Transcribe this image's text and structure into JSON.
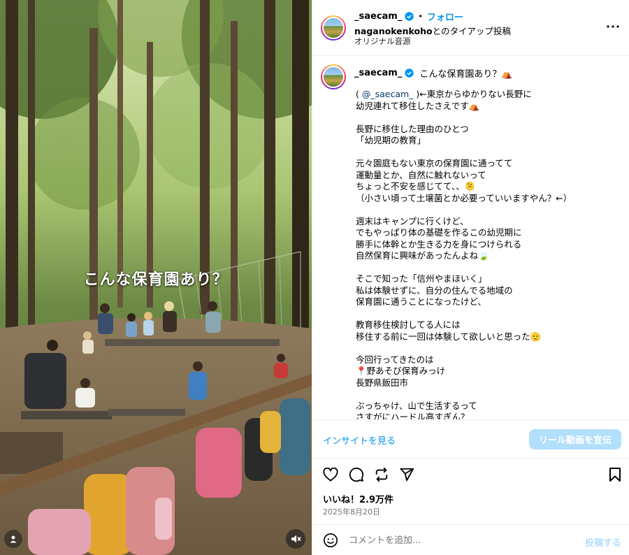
{
  "media": {
    "overlay_text": "こんな保育園あり？",
    "icons": {
      "user": "user-tag-icon",
      "sound": "muted-speaker-icon"
    }
  },
  "header": {
    "username": "_saecam_",
    "follow_label": "フォロー",
    "separator": "•",
    "partner_account": "naganokenkoho",
    "partner_suffix": "とのタイアップ投稿",
    "audio": "オリジナル音源",
    "icons": {
      "verified": "verified-badge-icon",
      "more": "more-options-icon"
    }
  },
  "caption": {
    "username": "_saecam_",
    "first_line": "こんな保育園あり？⛺",
    "mention": "@_saecam_",
    "body_after_mention": " )←東京からゆかりない長野に\n幼児連れて移住したさえです⛺\n\n長野に移住した理由のひとつ\n「幼児期の教育」\n\n元々園庭もない東京の保育園に通ってて\n運動量とか、自然に触れないって\nちょっと不安を感じてて、、🫠\n（小さい頃って土壌菌とか必要っていいますやん？←）\n\n週末はキャンプに行くけど、\nでもやっぱり体の基礎を作るこの幼児期に\n勝手に体幹とか生きる力を身につけられる\n自然保育に興味があったんよね🍃\n\nそこで知った「信州やまほいく」\n私は体験せずに、自分の住んでる地域の\n保育園に通うことになったけど、\n\n教育移住検討してる人には\n移住する前に一回は体験して欲しいと思った🫡\n\n今回行ってきたのは\n📍野あそび保育みっけ\n長野県飯田市\n\nぶっちゃけ、山で生活するって\nさすがにハードル高すぎん？",
    "open_paren": "( "
  },
  "insights": {
    "link_label": "インサイトを見る",
    "promote_label": "リール動画を宣伝"
  },
  "actions": {
    "icons": [
      "like-heart-icon",
      "comment-icon",
      "share-repost-icon",
      "send-icon",
      "save-bookmark-icon"
    ]
  },
  "stats": {
    "likes_text": "いいね！2.9万件",
    "date_text": "2025年8月20日"
  },
  "comment_box": {
    "placeholder": "コメントを追加...",
    "post_label": "投稿する",
    "emoji_icon": "emoji-smile-icon"
  },
  "colors": {
    "link_blue": "#0095f6",
    "button_disabled": "#b2dffc",
    "divider": "#efefef",
    "secondary_text": "#737373"
  }
}
